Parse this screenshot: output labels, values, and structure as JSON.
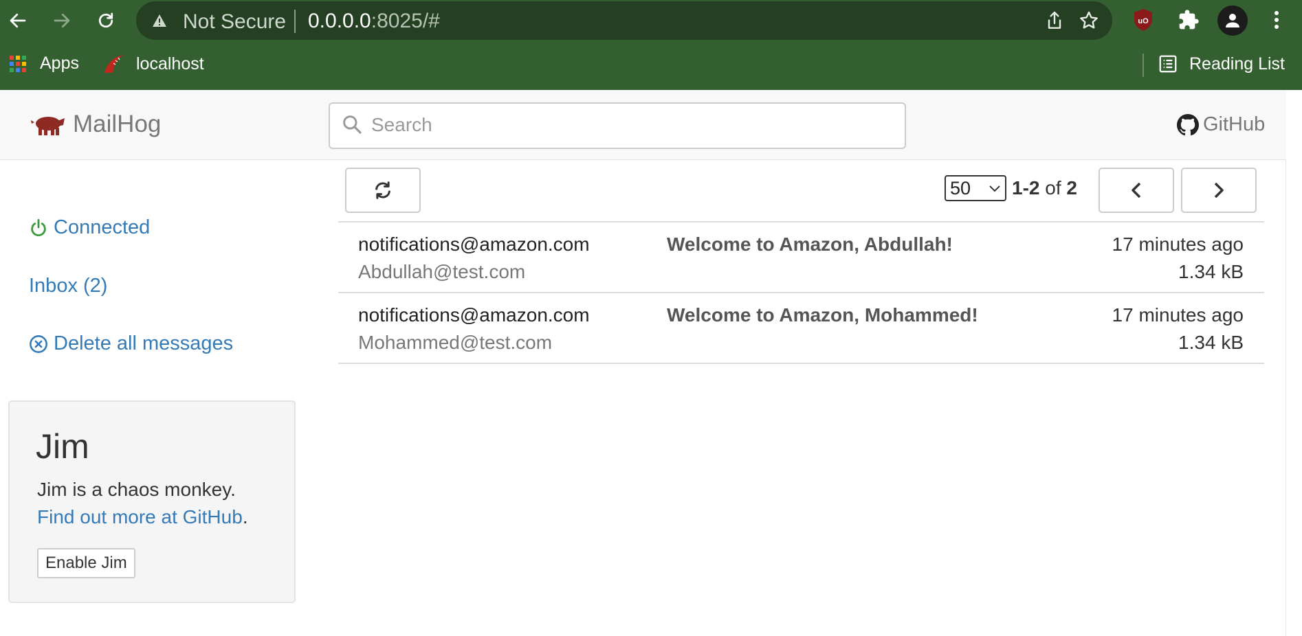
{
  "browser": {
    "security_label": "Not Secure",
    "url_host": "0.0.0.0",
    "url_rest": ":8025/#",
    "bookmarks": [
      {
        "label": "Apps"
      },
      {
        "label": "localhost"
      }
    ],
    "reading_list_label": "Reading List",
    "ublock_label": "uO"
  },
  "navbar": {
    "brand": "MailHog",
    "search_placeholder": "Search",
    "github_label": "GitHub"
  },
  "sidebar": {
    "connected_label": "Connected",
    "inbox_label": "Inbox (2)",
    "delete_label": "Delete all messages"
  },
  "jim": {
    "title": "Jim",
    "description": "Jim is a chaos monkey.",
    "link_text": "Find out more at GitHub",
    "link_suffix": ".",
    "button_label": "Enable Jim"
  },
  "toolbar": {
    "per_page": "50",
    "range": "1-2",
    "of_label": "of",
    "total": "2"
  },
  "messages": [
    {
      "from": "notifications@amazon.com",
      "to": "Abdullah@test.com",
      "subject": "Welcome to Amazon, Abdullah!",
      "time": "17 minutes ago",
      "size": "1.34 kB"
    },
    {
      "from": "notifications@amazon.com",
      "to": "Mohammed@test.com",
      "subject": "Welcome to Amazon, Mohammed!",
      "time": "17 minutes ago",
      "size": "1.34 kB"
    }
  ],
  "colors": {
    "chrome_bg": "#345f30",
    "omnibox_bg": "#243f22",
    "link": "#337ab7",
    "connected": "#3c9a3c",
    "brand_pig": "#8e2a24"
  }
}
